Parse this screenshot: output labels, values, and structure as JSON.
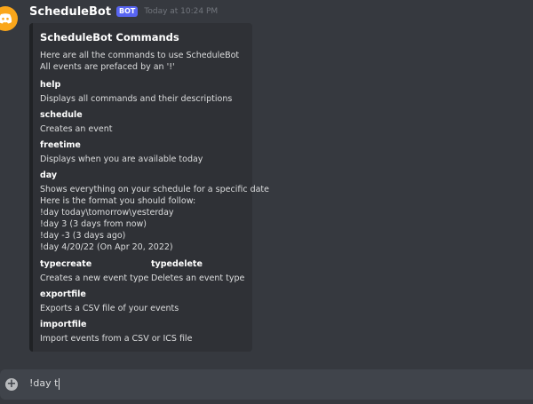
{
  "message": {
    "author": "ScheduleBot",
    "badge": "BOT",
    "timestamp": "Today at 10:24 PM",
    "avatar_icon": "discord-logo-icon",
    "avatar_color": "#faa61a"
  },
  "embed": {
    "title": "ScheduleBot Commands",
    "description_lines": [
      "Here are all the commands to use ScheduleBot",
      "All events are prefaced by an '!'"
    ],
    "fields": [
      {
        "name": "help",
        "value": [
          "Displays all commands and their descriptions"
        ]
      },
      {
        "name": "schedule",
        "value": [
          "Creates an event"
        ]
      },
      {
        "name": "freetime",
        "value": [
          "Displays when you are available today"
        ]
      },
      {
        "name": "day",
        "value": [
          "Shows everything on your schedule for a specific date",
          "Here is the format you should follow:",
          "!day today\\tomorrow\\yesterday",
          "!day 3 (3 days from now)",
          "!day -3 (3 days ago)",
          "!day 4/20/22 (On Apr 20, 2022)"
        ]
      },
      {
        "name": "typecreate",
        "value": [
          "Creates a new event type"
        ]
      },
      {
        "name": "typedelete",
        "value": [
          "Deletes an event type"
        ]
      },
      {
        "name": "exportfile",
        "value": [
          "Exports a CSV file of your events"
        ]
      },
      {
        "name": "importfile",
        "value": [
          "Import events from a CSV or ICS file"
        ]
      }
    ]
  },
  "composer": {
    "value": "!day t",
    "add_icon": "plus-circle-icon"
  },
  "colors": {
    "background": "#36393f",
    "embed_bg": "#2f3136",
    "bot_badge": "#5865f2",
    "composer_bg": "#40444b"
  }
}
